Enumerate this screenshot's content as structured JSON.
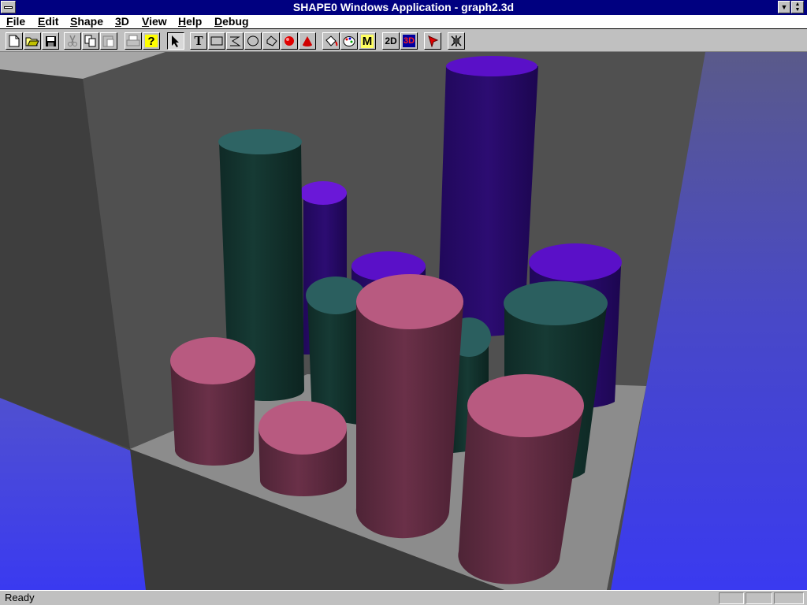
{
  "window": {
    "title": "SHAPE0 Windows Application - graph2.3d"
  },
  "menu": [
    {
      "label": "File"
    },
    {
      "label": "Edit"
    },
    {
      "label": "Shape"
    },
    {
      "label": "3D"
    },
    {
      "label": "View"
    },
    {
      "label": "Help"
    },
    {
      "label": "Debug"
    }
  ],
  "toolbar": {
    "buttons": [
      {
        "icon": "new-file-icon"
      },
      {
        "icon": "open-folder-icon"
      },
      {
        "icon": "save-disk-icon"
      },
      {
        "icon": "cut-scissors-icon"
      },
      {
        "icon": "copy-icon"
      },
      {
        "icon": "paste-icon"
      },
      {
        "icon": "print-icon"
      },
      {
        "icon": "help-question-icon",
        "text": "?"
      },
      {
        "icon": "pointer-arrow-icon"
      },
      {
        "icon": "text-tool-icon",
        "text": "T"
      },
      {
        "icon": "rectangle-tool-icon"
      },
      {
        "icon": "polyline-tool-icon"
      },
      {
        "icon": "ellipse-tool-icon"
      },
      {
        "icon": "polygon-tool-icon"
      },
      {
        "icon": "sphere-tool-icon"
      },
      {
        "icon": "cone-tool-icon"
      },
      {
        "icon": "paint-bucket-icon"
      },
      {
        "icon": "palette-icon"
      },
      {
        "icon": "material-icon",
        "text": "M"
      },
      {
        "icon": "view-2d-icon",
        "text": "2D"
      },
      {
        "icon": "view-3d-icon",
        "text": "3D"
      },
      {
        "icon": "pin-icon"
      },
      {
        "icon": "debug-icon"
      }
    ]
  },
  "scene": {
    "colors": {
      "teal": "#2b5f5f",
      "purple": "#5a10c8",
      "pink": "#b85a80",
      "floor": "#8c8c8c",
      "background_blue": "#4646e0"
    }
  },
  "status": {
    "text": "Ready"
  }
}
